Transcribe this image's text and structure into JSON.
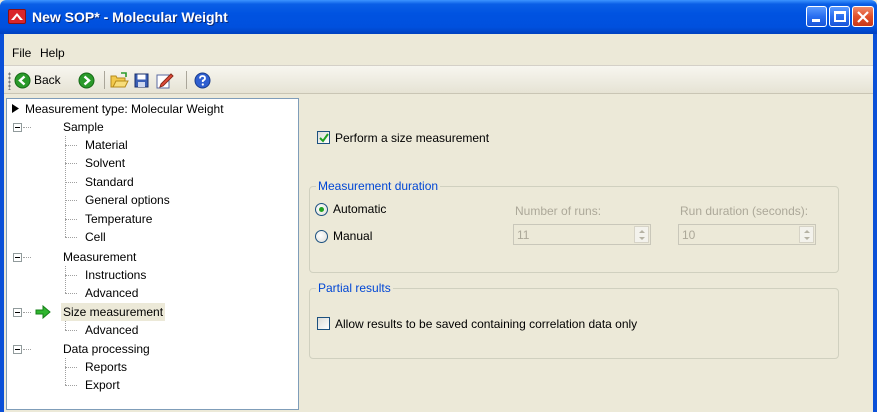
{
  "window": {
    "title": "New SOP* - Molecular Weight",
    "colors": {
      "titlebar": "#0053e1",
      "accent": "#0046d5",
      "close": "#e0502a"
    }
  },
  "menu": {
    "file": "File",
    "help": "Help"
  },
  "toolbar": {
    "back_label": "Back",
    "icons": [
      "back-icon",
      "forward-icon",
      "open-folder-icon",
      "save-icon",
      "edit-icon",
      "help-icon"
    ]
  },
  "tree": {
    "root": "Measurement type: Molecular Weight",
    "sample": "Sample",
    "sample_children": [
      "Material",
      "Solvent",
      "Standard",
      "General options",
      "Temperature",
      "Cell"
    ],
    "measurement": "Measurement",
    "measurement_children": [
      "Instructions",
      "Advanced"
    ],
    "size_measurement": "Size measurement",
    "size_children": [
      "Advanced"
    ],
    "data_processing": "Data processing",
    "data_children": [
      "Reports",
      "Export"
    ]
  },
  "content": {
    "perform_size": {
      "label": "Perform a size measurement",
      "checked": true
    },
    "duration_group": {
      "title": "Measurement duration",
      "automatic": "Automatic",
      "manual": "Manual",
      "selected": "Automatic",
      "runs_label": "Number of runs:",
      "runs_value": "11",
      "run_duration_label": "Run duration (seconds):",
      "run_duration_value": "10"
    },
    "partial_group": {
      "title": "Partial results",
      "allow_label": "Allow results to be saved containing correlation data only",
      "allow_checked": false
    }
  }
}
